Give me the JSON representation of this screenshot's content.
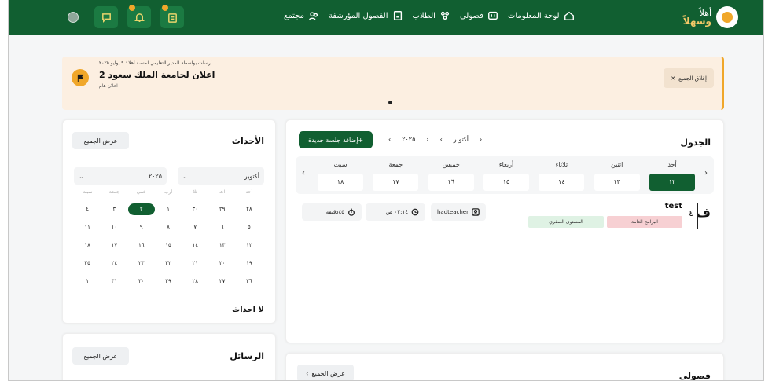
{
  "brand": {
    "line1": "أهلاً",
    "line2": "وسهلاً"
  },
  "nav": [
    {
      "label": "لوحة المعلومات",
      "icon": "home-icon"
    },
    {
      "label": "فصولي",
      "icon": "book-icon"
    },
    {
      "label": "الطلاب",
      "icon": "students-icon"
    },
    {
      "label": "الفصول المؤرشفة",
      "icon": "archive-icon"
    },
    {
      "label": "مجتمع",
      "icon": "community-icon"
    }
  ],
  "announcement": {
    "meta": "أرسلت بواسطة المدير التعليمي لمنصة أهلا : ٩ يوليو ٢٠٢٥",
    "title": "اعلان لجامعة الملك سعود 2",
    "subtitle": "اعلان هام",
    "close_label": "إغلاق الجميع"
  },
  "events": {
    "title": "الأحداث",
    "view_all": "عرض الجميع",
    "month": "أكتوبر",
    "year": "٢٠٢٥",
    "weekdays": [
      "أحد",
      "اث",
      "ثلا",
      "أرب",
      "خمي",
      "جمعة",
      "سبت"
    ],
    "rows": [
      [
        "٢٨",
        "٢٩",
        "٣٠",
        "١",
        "٢",
        "٣",
        "٤"
      ],
      [
        "٥",
        "٦",
        "٧",
        "٨",
        "٩",
        "١٠",
        "١١"
      ],
      [
        "١٢",
        "١٣",
        "١٤",
        "١٥",
        "١٦",
        "١٧",
        "١٨"
      ],
      [
        "١٩",
        "٢٠",
        "٢١",
        "٢٢",
        "٢٣",
        "٢٤",
        "٢٥"
      ],
      [
        "٢٦",
        "٢٧",
        "٢٨",
        "٢٩",
        "٣٠",
        "٣١",
        "١"
      ]
    ],
    "selected": "٢",
    "empty": "لا احداث"
  },
  "messages": {
    "title": "الرسائل",
    "view_all": "عرض الجميع"
  },
  "schedule": {
    "title": "الجدول",
    "add_button": "+إضافة جلسة جديدة",
    "month_label": "أكتوبر",
    "year_label": "٢٠٢٥",
    "days": [
      {
        "name": "أحد",
        "num": "١٢"
      },
      {
        "name": "اثنين",
        "num": "١٣"
      },
      {
        "name": "ثلاثاء",
        "num": "١٤"
      },
      {
        "name": "أربعاء",
        "num": "١٥"
      },
      {
        "name": "خميس",
        "num": "١٦"
      },
      {
        "name": "جمعة",
        "num": "١٧"
      },
      {
        "name": "سبت",
        "num": "١٨"
      }
    ],
    "session": {
      "letter": "ف",
      "number": "٤",
      "name": "test",
      "tag1": "البرامج العامة",
      "tag2": "المستوى الصفري",
      "teacher": "hadteacher",
      "time": "٠٢:١٤ ص",
      "duration": "٤٥دقيقة"
    }
  },
  "my_classes": {
    "title": "فصولي",
    "view_all": "عرض الجميع"
  },
  "colors": {
    "primary": "#115f31",
    "accent": "#f0a72a",
    "announcement_bg": "#fcefe1",
    "tag1_bg": "#f7d0d3",
    "tag2_bg": "#dff2e4"
  }
}
